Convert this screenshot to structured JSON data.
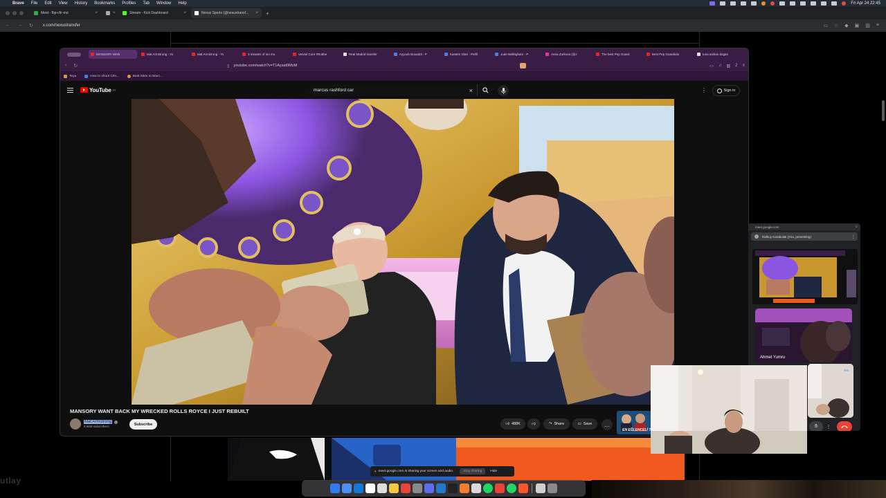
{
  "menubar": {
    "apple": "",
    "app": "Brave",
    "items": [
      "File",
      "Edit",
      "View",
      "History",
      "Bookmarks",
      "Profiles",
      "Tab",
      "Window",
      "Help"
    ],
    "clock": "Fri Apr 24  22:45"
  },
  "outer_browser": {
    "tabs": [
      {
        "label": "Meet - fbp-cfir-mic",
        "favicon_color": "#34a853",
        "active": false
      },
      {
        "label": "",
        "favicon_color": "#aaaaaa",
        "active": false
      },
      {
        "label": "Stream - Kick Dashboard",
        "favicon_color": "#53fc18",
        "active": false
      },
      {
        "label": "Nexus Sports (@nexustransf...",
        "favicon_color": "#ffffff",
        "active": true
      }
    ],
    "new_tab": "+",
    "url": "x.com/nexustransfer"
  },
  "inner_browser": {
    "tabs": [
      {
        "label": "MANSORY WAN",
        "favicon": "yt",
        "active": true
      },
      {
        "label": "Mat Armstrong - Yo",
        "favicon": "yt"
      },
      {
        "label": "Mat Armstrong - Yo",
        "favicon": "yt"
      },
      {
        "label": "3 minutes of ieo mo",
        "favicon": "yt"
      },
      {
        "label": "Vessel Core #Rubbe",
        "favicon": "yt"
      },
      {
        "label": "Real Madrid transfer",
        "favicon": "w"
      },
      {
        "label": "Ayyoub Bouaddi - P",
        "favicon": "b"
      },
      {
        "label": "Kastem Glari - Perfil",
        "favicon": "b"
      },
      {
        "label": "Jude Bellingham - P",
        "favicon": "b"
      },
      {
        "label": "Anna Zurkova (@z",
        "favicon": "ig"
      },
      {
        "label": "The best Pep Guard",
        "favicon": "yt"
      },
      {
        "label": "Best Pep Guardiola",
        "favicon": "yt"
      },
      {
        "label": "tuna asihan dogan",
        "favicon": "w"
      }
    ],
    "url": "youtube.com/watch?v=T1Aysat0MoM",
    "tab_count": "2",
    "bookmarks": [
      "Teya",
      "How to shoot CIN...",
      "Best Sites to Warc..."
    ]
  },
  "youtube": {
    "logo_text": "YouTube",
    "logo_region": "PT",
    "search_value": "marcus rashford car",
    "sign_in": "Sign in",
    "video_title": "MANSORY WANT BACK MY WRECKED ROLLS ROYCE I JUST REBUILT",
    "channel_name": "Mat Armstrong",
    "subscribers": "6.66M subscribers",
    "subscribe": "Subscribe",
    "likes": "488K",
    "share": "Share",
    "save": "Save",
    "next_thumb_text": "EN EĞLENCELİ T"
  },
  "meet": {
    "url": "meet.google.com",
    "presenting": "Rafkuy Karabulak (You, presenting)",
    "participant_name": "Ahmet Yumru"
  },
  "sharebar": {
    "message": "meet.google.com is sharing your screen and audio.",
    "stop": "Stop sharing",
    "hide": "Hide"
  },
  "desktop_text": "utlay",
  "colors": {
    "youtube_red": "#ff0000",
    "inner_tabbar": "#3a1d45",
    "leave_call": "#ea4335",
    "subscribe_bg": "#f1f1f1"
  }
}
